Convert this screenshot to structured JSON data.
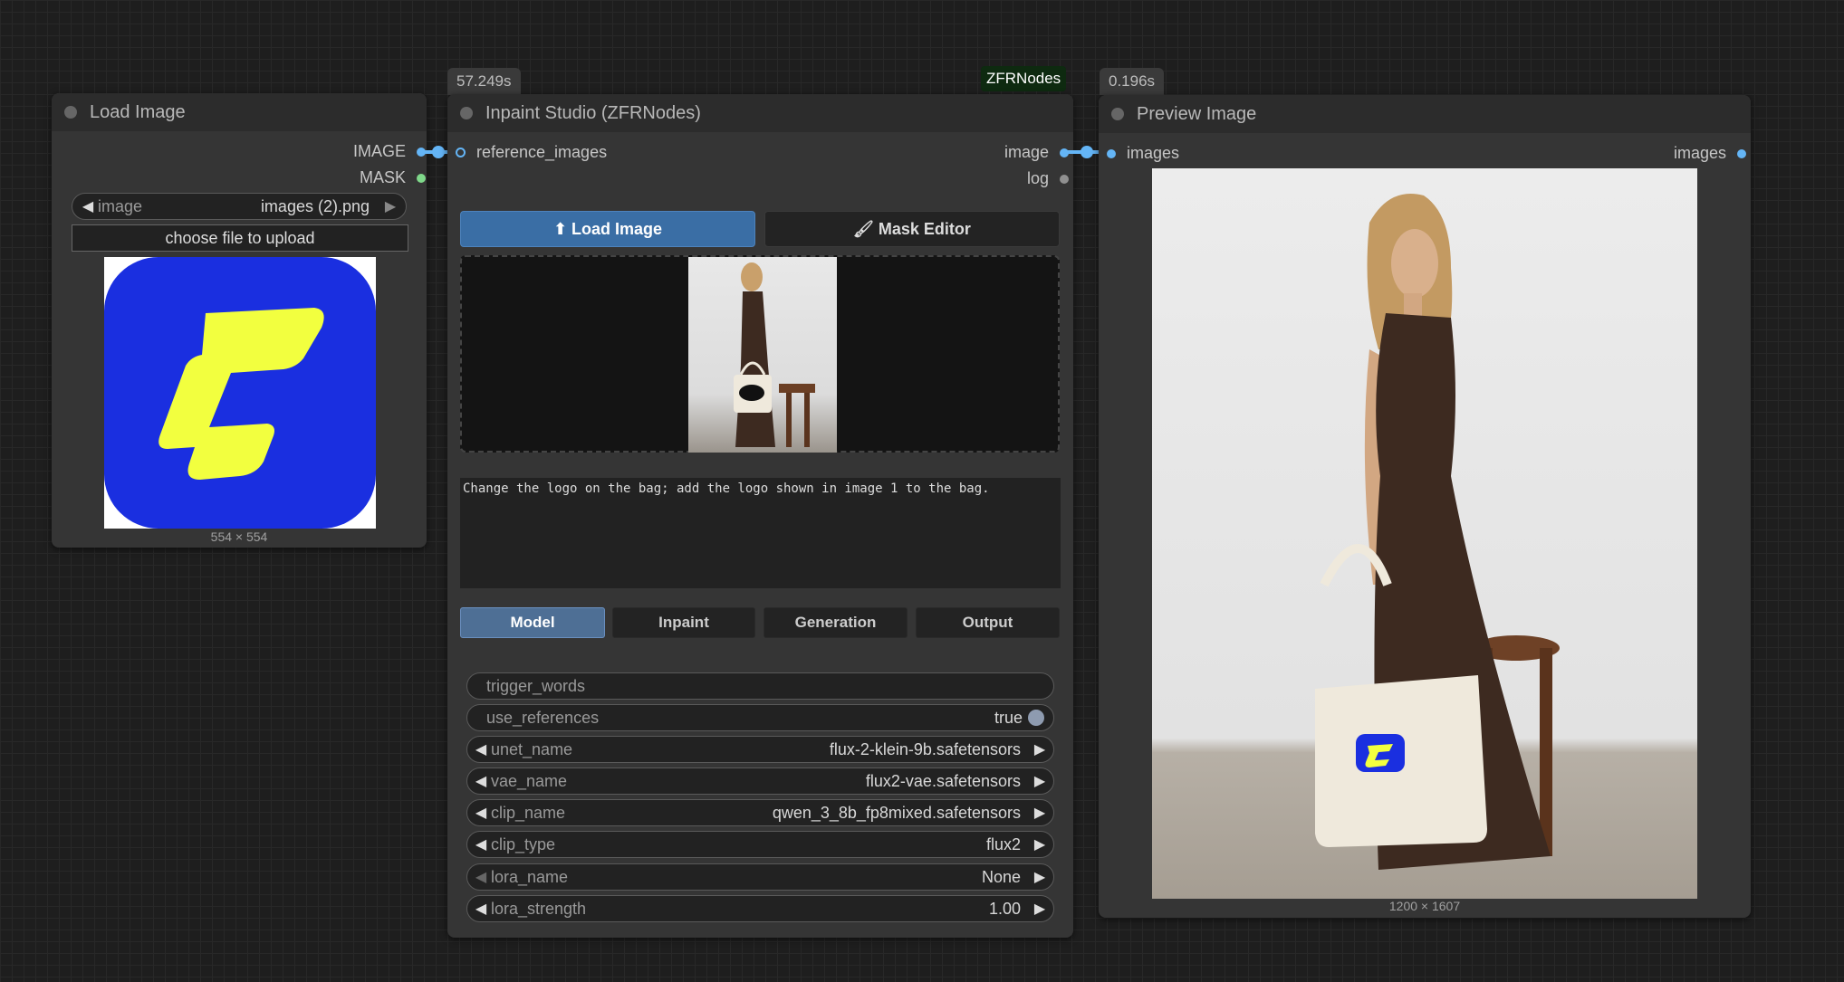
{
  "load_image_node": {
    "title": "Load Image",
    "outputs": [
      "IMAGE",
      "MASK"
    ],
    "image_widget": {
      "label": "image",
      "value": "images (2).png"
    },
    "upload_button": "choose file to upload",
    "image_size": "554 × 554",
    "logo_colors": {
      "background": "#1a2fe0",
      "glyph": "#f2ff3f"
    }
  },
  "inpaint_node": {
    "time": "57.249s",
    "badge": "ZFRNodes",
    "title": "Inpaint Studio (ZFRNodes)",
    "input": "reference_images",
    "outputs": [
      "image",
      "log"
    ],
    "load_image_button": "⬆ Load Image",
    "mask_editor_button": "🖌 Mask Editor",
    "prompt": "Change the logo on the bag; add the logo shown in image 1 to the bag.",
    "tabs": [
      {
        "label": "Model",
        "active": true
      },
      {
        "label": "Inpaint",
        "active": false
      },
      {
        "label": "Generation",
        "active": false
      },
      {
        "label": "Output",
        "active": false
      }
    ],
    "widgets": {
      "trigger_words": {
        "label": "trigger_words",
        "value": ""
      },
      "use_references": {
        "label": "use_references",
        "value": "true"
      },
      "unet_name": {
        "label": "unet_name",
        "value": "flux-2-klein-9b.safetensors"
      },
      "vae_name": {
        "label": "vae_name",
        "value": "flux2-vae.safetensors"
      },
      "clip_name": {
        "label": "clip_name",
        "value": "qwen_3_8b_fp8mixed.safetensors"
      },
      "clip_type": {
        "label": "clip_type",
        "value": "flux2"
      },
      "lora_name": {
        "label": "lora_name",
        "value": "None"
      },
      "lora_strength": {
        "label": "lora_strength",
        "value": "1.00"
      }
    }
  },
  "preview_node": {
    "time": "0.196s",
    "title": "Preview Image",
    "input": "images",
    "output": "images",
    "image_size": "1200 × 1607"
  },
  "colors": {
    "link": "#64b5f6",
    "mask_slot": "#7fd88a",
    "accent_tab": "#4e6f95",
    "load_btn": "#3a6ea5"
  }
}
